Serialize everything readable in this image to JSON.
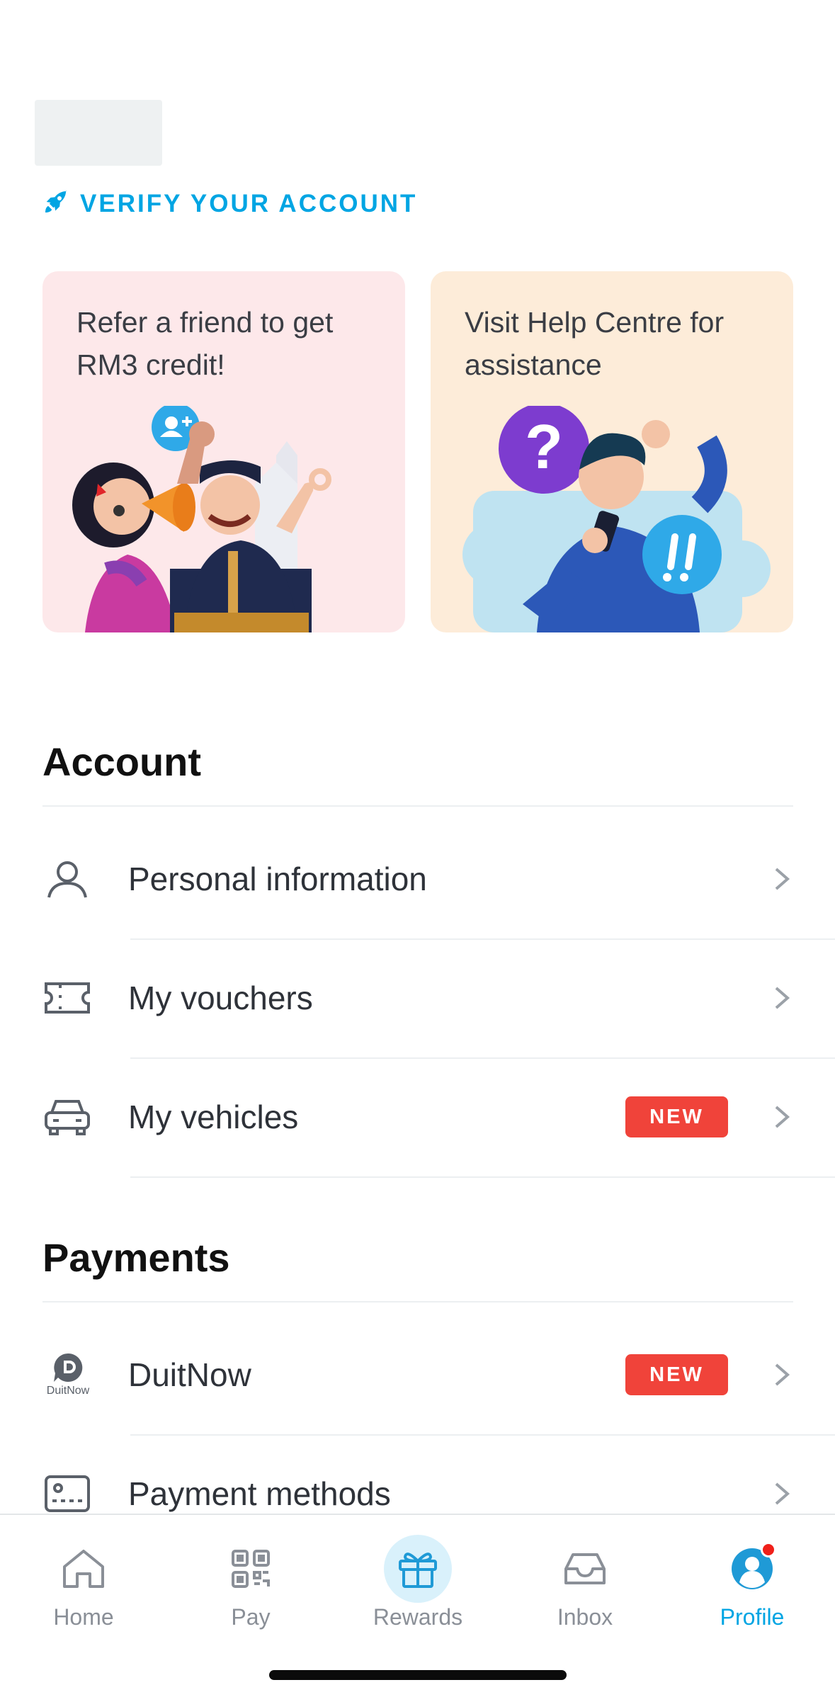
{
  "header": {
    "verify_label": "VERIFY YOUR ACCOUNT"
  },
  "cards": [
    {
      "title": "Refer a friend to get RM3 credit!"
    },
    {
      "title": "Visit Help Centre for assistance"
    }
  ],
  "account": {
    "title": "Account",
    "items": [
      {
        "label": "Personal information",
        "icon": "user-icon"
      },
      {
        "label": "My vouchers",
        "icon": "ticket-icon"
      },
      {
        "label": "My vehicles",
        "icon": "car-icon",
        "badge": "NEW"
      }
    ]
  },
  "payments": {
    "title": "Payments",
    "items": [
      {
        "label": "DuitNow",
        "icon": "duitnow-logo",
        "icon_text": "DuitNow",
        "badge": "NEW"
      },
      {
        "label": "Payment methods",
        "icon": "card-icon"
      }
    ]
  },
  "tabbar": {
    "tabs": [
      {
        "label": "Home",
        "icon": "home-icon"
      },
      {
        "label": "Pay",
        "icon": "qr-icon"
      },
      {
        "label": "Rewards",
        "icon": "gift-icon"
      },
      {
        "label": "Inbox",
        "icon": "inbox-icon"
      },
      {
        "label": "Profile",
        "icon": "profile-icon",
        "active": true
      }
    ]
  },
  "colors": {
    "accent": "#00a5e3",
    "badge": "#f0433a",
    "refer_card_bg": "#fde8ea",
    "help_card_bg": "#fdecd9"
  }
}
